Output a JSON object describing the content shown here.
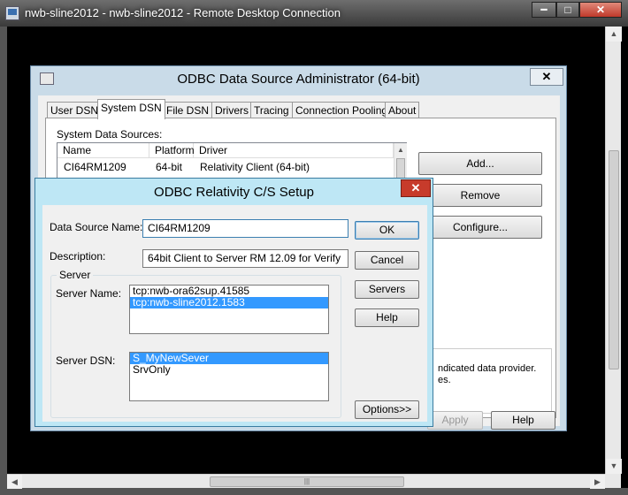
{
  "rdp": {
    "title": "nwb-sline2012 - nwb-sline2012 - Remote Desktop Connection",
    "min_glyph": "━",
    "max_glyph": "□",
    "close_glyph": "✕"
  },
  "scrollbars": {
    "up_glyph": "▲",
    "down_glyph": "▼",
    "left_glyph": "◀",
    "right_glyph": "▶",
    "grip": "|||"
  },
  "admin": {
    "title": "ODBC Data Source Administrator (64-bit)",
    "close_glyph": "✕",
    "tabs": [
      "User DSN",
      "System DSN",
      "File DSN",
      "Drivers",
      "Tracing",
      "Connection Pooling",
      "About"
    ],
    "active_tab": "System DSN",
    "list_label": "System Data Sources:",
    "columns": [
      "Name",
      "Platform",
      "Driver"
    ],
    "rows": [
      {
        "name": "CI64RM1209",
        "platform": "64-bit",
        "driver": "Relativity Client (64-bit)"
      }
    ],
    "buttons": {
      "add": "Add...",
      "remove": "Remove",
      "configure": "Configure...",
      "apply": "Apply",
      "help": "Help"
    },
    "description_fragment": [
      "ndicated data provider.",
      "es."
    ]
  },
  "setup": {
    "title": "ODBC Relativity C/S Setup",
    "close_glyph": "✕",
    "dsn_name_label": "Data Source Name:",
    "dsn_name_value": "CI64RM1209",
    "description_label": "Description:",
    "description_value": "64bit Client to Server RM 12.09 for Verify",
    "server_group_label": "Server",
    "server_name_label": "Server Name:",
    "server_names": [
      {
        "value": "tcp:nwb-ora62sup.41585",
        "selected": false
      },
      {
        "value": "tcp:nwb-sline2012.1583",
        "selected": true
      }
    ],
    "server_dsn_label": "Server DSN:",
    "server_dsns": [
      {
        "value": "S_MyNewSever",
        "selected": true
      },
      {
        "value": "SrvOnly",
        "selected": false
      }
    ],
    "buttons": {
      "ok": "OK",
      "cancel": "Cancel",
      "servers": "Servers",
      "help": "Help",
      "options": "Options>>"
    }
  }
}
